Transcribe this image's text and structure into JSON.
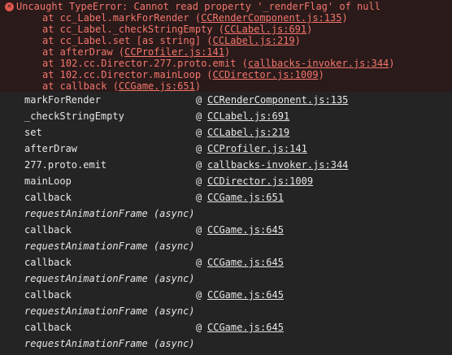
{
  "error": {
    "message": "Uncaught TypeError: Cannot read property '_renderFlag' of null",
    "frames": [
      {
        "prefix": "at cc_Label.markForRender (",
        "loc": "CCRenderComponent.js:135",
        "suffix": ")"
      },
      {
        "prefix": "at cc_Label._checkStringEmpty (",
        "loc": "CCLabel.js:691",
        "suffix": ")"
      },
      {
        "prefix": "at cc_Label.set [as string] (",
        "loc": "CCLabel.js:219",
        "suffix": ")"
      },
      {
        "prefix": "at afterDraw (",
        "loc": "CCProfiler.js:141",
        "suffix": ")"
      },
      {
        "prefix": "at 102.cc.Director.277.proto.emit (",
        "loc": "callbacks-invoker.js:344",
        "suffix": ")"
      },
      {
        "prefix": "at 102.cc.Director.mainLoop (",
        "loc": "CCDirector.js:1009",
        "suffix": ")"
      },
      {
        "prefix": "at callback (",
        "loc": "CCGame.js:651",
        "suffix": ")"
      }
    ]
  },
  "stack": [
    {
      "fn": "markForRender",
      "at": "@",
      "loc": "CCRenderComponent.js:135"
    },
    {
      "fn": "_checkStringEmpty",
      "at": "@",
      "loc": "CCLabel.js:691"
    },
    {
      "fn": "set",
      "at": "@",
      "loc": "CCLabel.js:219"
    },
    {
      "fn": "afterDraw",
      "at": "@",
      "loc": "CCProfiler.js:141"
    },
    {
      "fn": "277.proto.emit",
      "at": "@",
      "loc": "callbacks-invoker.js:344"
    },
    {
      "fn": "mainLoop",
      "at": "@",
      "loc": "CCDirector.js:1009"
    },
    {
      "fn": "callback",
      "at": "@",
      "loc": "CCGame.js:651"
    },
    {
      "async": "requestAnimationFrame (async)"
    },
    {
      "fn": "callback",
      "at": "@",
      "loc": "CCGame.js:645"
    },
    {
      "async": "requestAnimationFrame (async)"
    },
    {
      "fn": "callback",
      "at": "@",
      "loc": "CCGame.js:645"
    },
    {
      "async": "requestAnimationFrame (async)"
    },
    {
      "fn": "callback",
      "at": "@",
      "loc": "CCGame.js:645"
    },
    {
      "async": "requestAnimationFrame (async)"
    },
    {
      "fn": "callback",
      "at": "@",
      "loc": "CCGame.js:645"
    },
    {
      "async": "requestAnimationFrame (async)"
    }
  ],
  "icons": {
    "error_icon": "error-circle-icon"
  },
  "colors": {
    "background": "#242424",
    "error_background": "#2a1a1a",
    "error_text": "#f4766c",
    "text": "#e6e6e6"
  }
}
